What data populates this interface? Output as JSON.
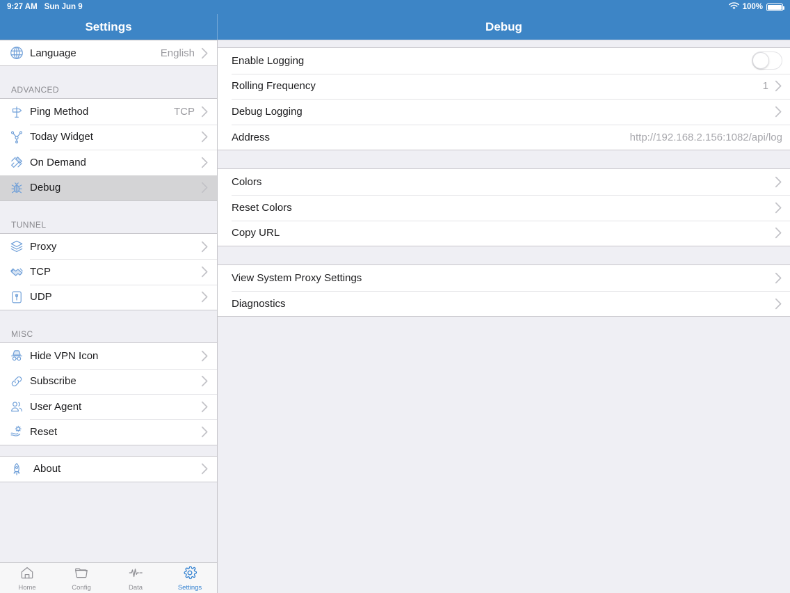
{
  "status_bar": {
    "time": "9:27 AM",
    "date": "Sun Jun 9",
    "battery_percent": "100%",
    "wifi_icon": "wifi-icon",
    "battery_icon": "battery-icon"
  },
  "nav": {
    "left_title": "Settings",
    "right_title": "Debug"
  },
  "theme": {
    "accent": "#3d85c6",
    "tint": "#2f7fd0",
    "icon_blue": "#6f9fd8",
    "background": "#efeff4",
    "card": "#ffffff",
    "separator": "#c8c7cc",
    "selected_row": "#d4d4d6",
    "secondary_text": "#9a9a9f"
  },
  "sidebar": {
    "groups": [
      {
        "header": "",
        "items": [
          {
            "icon": "globe-icon",
            "label": "Language",
            "value": "English",
            "chevron": true,
            "selected": false
          }
        ]
      },
      {
        "header": "ADVANCED",
        "items": [
          {
            "icon": "signpost-icon",
            "label": "Ping Method",
            "value": "TCP",
            "chevron": true,
            "selected": false
          },
          {
            "icon": "network-node-icon",
            "label": "Today Widget",
            "value": "",
            "chevron": true,
            "selected": false
          },
          {
            "icon": "satellite-icon",
            "label": "On Demand",
            "value": "",
            "chevron": true,
            "selected": false
          },
          {
            "icon": "bug-icon",
            "label": "Debug",
            "value": "",
            "chevron": true,
            "selected": true
          }
        ]
      },
      {
        "header": "TUNNEL",
        "items": [
          {
            "icon": "layers-icon",
            "label": "Proxy",
            "value": "",
            "chevron": true,
            "selected": false
          },
          {
            "icon": "handshake-icon",
            "label": "TCP",
            "value": "",
            "chevron": true,
            "selected": false
          },
          {
            "icon": "antenna-icon",
            "label": "UDP",
            "value": "",
            "chevron": true,
            "selected": false
          }
        ]
      },
      {
        "header": "MISC",
        "items": [
          {
            "icon": "incognito-icon",
            "label": "Hide VPN Icon",
            "value": "",
            "chevron": true,
            "selected": false
          },
          {
            "icon": "link-icon",
            "label": "Subscribe",
            "value": "",
            "chevron": true,
            "selected": false
          },
          {
            "icon": "users-icon",
            "label": "User Agent",
            "value": "",
            "chevron": true,
            "selected": false
          },
          {
            "icon": "hand-gear-icon",
            "label": "Reset",
            "value": "",
            "chevron": true,
            "selected": false
          }
        ]
      },
      {
        "header": "",
        "items": [
          {
            "icon": "rocket-icon",
            "label": "About",
            "value": "",
            "chevron": true,
            "selected": false,
            "indent": true
          }
        ]
      }
    ]
  },
  "tabbar": {
    "tabs": [
      {
        "icon": "home-icon",
        "label": "Home",
        "active": false
      },
      {
        "icon": "folder-icon",
        "label": "Config",
        "active": false
      },
      {
        "icon": "waveform-icon",
        "label": "Data",
        "active": false
      },
      {
        "icon": "gear-icon",
        "label": "Settings",
        "active": true
      }
    ]
  },
  "detail": {
    "groups": [
      {
        "rows": [
          {
            "label": "Enable Logging",
            "value": "",
            "control": "toggle",
            "toggle_on": false,
            "chevron": false
          },
          {
            "label": "Rolling Frequency",
            "value": "1",
            "control": "value",
            "chevron": true
          },
          {
            "label": "Debug Logging",
            "value": "",
            "control": "value",
            "chevron": true
          },
          {
            "label": "Address",
            "value": "http://192.168.2.156:1082/api/log",
            "control": "value",
            "chevron": false
          }
        ]
      },
      {
        "rows": [
          {
            "label": "Colors",
            "value": "",
            "control": "value",
            "chevron": true
          },
          {
            "label": "Reset Colors",
            "value": "",
            "control": "value",
            "chevron": true
          },
          {
            "label": "Copy URL",
            "value": "",
            "control": "value",
            "chevron": true
          }
        ]
      },
      {
        "rows": [
          {
            "label": "View System Proxy Settings",
            "value": "",
            "control": "value",
            "chevron": true
          },
          {
            "label": "Diagnostics",
            "value": "",
            "control": "value",
            "chevron": true
          }
        ]
      }
    ]
  }
}
